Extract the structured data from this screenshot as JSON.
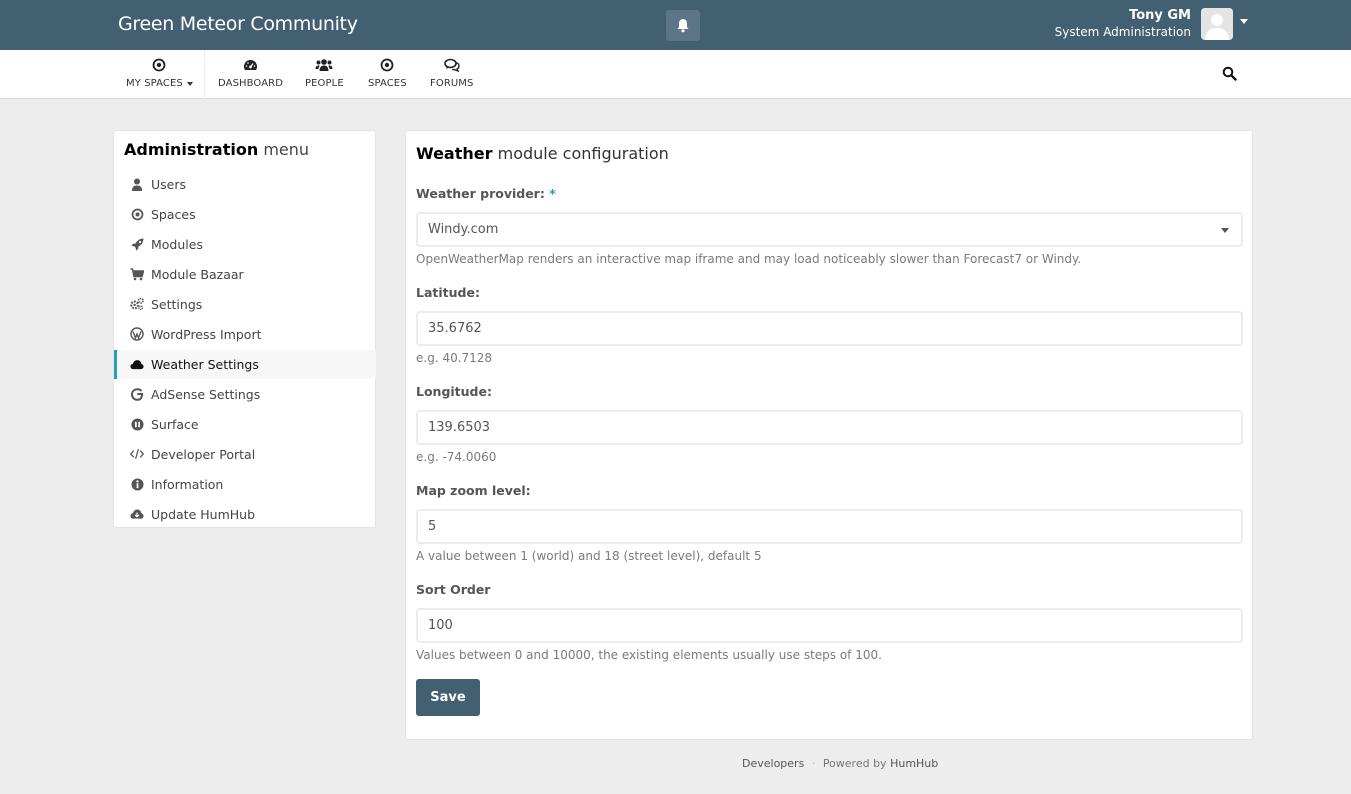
{
  "topbar": {
    "brand": "Green Meteor Community",
    "user_name": "Tony GM",
    "user_role": "System Administration"
  },
  "nav": {
    "items": [
      {
        "label": "MY SPACES",
        "icon": "dot-circle-icon"
      },
      {
        "label": "DASHBOARD",
        "icon": "dashboard-icon"
      },
      {
        "label": "PEOPLE",
        "icon": "users-icon"
      },
      {
        "label": "SPACES",
        "icon": "dot-circle-icon"
      },
      {
        "label": "FORUMS",
        "icon": "comments-icon"
      }
    ]
  },
  "sidebar": {
    "title_bold": "Administration",
    "title_rest": "menu",
    "items": [
      {
        "label": "Users",
        "icon": "user-icon"
      },
      {
        "label": "Spaces",
        "icon": "dot-circle-icon"
      },
      {
        "label": "Modules",
        "icon": "rocket-icon"
      },
      {
        "label": "Module Bazaar",
        "icon": "cart-icon"
      },
      {
        "label": "Settings",
        "icon": "cogs-icon"
      },
      {
        "label": "WordPress Import",
        "icon": "wordpress-icon"
      },
      {
        "label": "Weather Settings",
        "icon": "cloud-icon",
        "active": true
      },
      {
        "label": "AdSense Settings",
        "icon": "google-icon"
      },
      {
        "label": "Surface",
        "icon": "pause-circle-icon"
      },
      {
        "label": "Developer Portal",
        "icon": "code-icon"
      },
      {
        "label": "Information",
        "icon": "info-circle-icon"
      },
      {
        "label": "Update HumHub",
        "icon": "cloud-download-icon"
      }
    ]
  },
  "main": {
    "title_bold": "Weather",
    "title_rest": "module configuration",
    "provider_label": "Weather provider:",
    "provider_required": "*",
    "provider_value": "Windy.com",
    "provider_hint": "OpenWeatherMap renders an interactive map iframe and may load noticeably slower than Forecast7 or Windy.",
    "latitude_label": "Latitude:",
    "latitude_value": "35.6762",
    "latitude_hint": "e.g. 40.7128",
    "longitude_label": "Longitude:",
    "longitude_value": "139.6503",
    "longitude_hint": "e.g. -74.0060",
    "zoom_label": "Map zoom level:",
    "zoom_value": "5",
    "zoom_hint": "A value between 1 (world) and 18 (street level), default 5",
    "sort_label": "Sort Order",
    "sort_value": "100",
    "sort_hint": "Values between 0 and 10000, the existing elements usually use steps of 100.",
    "save_label": "Save"
  },
  "footer": {
    "developers": "Developers",
    "separator": "·",
    "powered_by": "Powered by",
    "humhub": "HumHub"
  },
  "colors": {
    "topbar": "#435f72",
    "accent": "#21a1b3",
    "button": "#435f72",
    "background": "#ededed"
  }
}
